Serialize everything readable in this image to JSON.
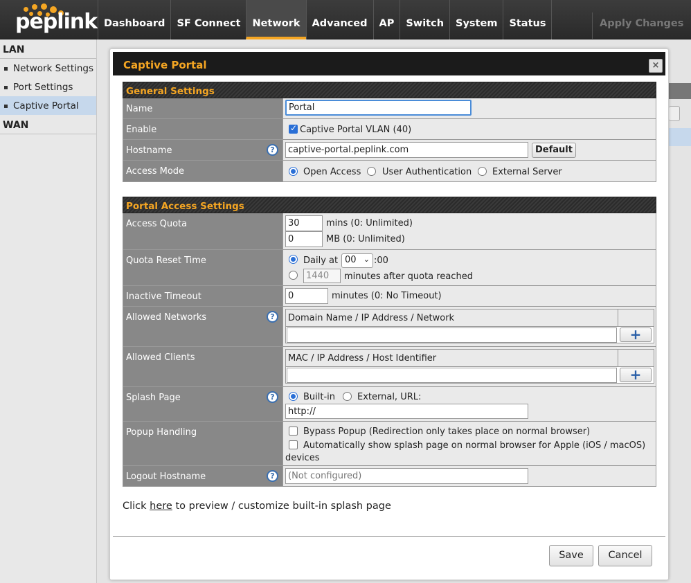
{
  "brand": {
    "logo_text": "peplink",
    "accent": "#f5a623"
  },
  "nav": {
    "items": [
      "Dashboard",
      "SF Connect",
      "Network",
      "Advanced",
      "AP",
      "Switch",
      "System",
      "Status"
    ],
    "active": "Network",
    "apply_label": "Apply Changes"
  },
  "sidebar": {
    "lan_header": "LAN",
    "items": [
      "Network Settings",
      "Port Settings",
      "Captive Portal"
    ],
    "active": "Captive Portal",
    "wan_header": "WAN"
  },
  "dialog": {
    "title": "Captive Portal",
    "close_icon": "×",
    "general": {
      "header": "General Settings",
      "name_label": "Name",
      "name_value": "Portal",
      "enable_label": "Enable",
      "enable_text": "Captive Portal VLAN (40)",
      "hostname_label": "Hostname",
      "hostname_value": "captive-portal.peplink.com",
      "default_button": "Default",
      "access_mode_label": "Access Mode",
      "access_modes": [
        "Open Access",
        "User Authentication",
        "External Server"
      ]
    },
    "portal": {
      "header": "Portal Access Settings",
      "quota_label": "Access Quota",
      "quota_mins_value": "30",
      "quota_mins_text": "mins (0: Unlimited)",
      "quota_mb_value": "0",
      "quota_mb_text": "MB (0: Unlimited)",
      "reset_label": "Quota Reset Time",
      "reset_daily_text": "Daily at",
      "reset_hour": "00",
      "reset_suffix": ":00",
      "reset_minutes_value": "1440",
      "reset_minutes_text": "minutes after quota reached",
      "inactive_label": "Inactive Timeout",
      "inactive_value": "0",
      "inactive_text": "minutes (0: No Timeout)",
      "allowed_networks_label": "Allowed Networks",
      "allowed_networks_header": "Domain Name / IP Address / Network",
      "allowed_clients_label": "Allowed Clients",
      "allowed_clients_header": "MAC / IP Address / Host Identifier",
      "plus_icon": "+",
      "splash_label": "Splash Page",
      "splash_builtin": "Built-in",
      "splash_external": "External, URL:",
      "splash_url_value": "http://",
      "popup_label": "Popup Handling",
      "popup_bypass": "Bypass Popup (Redirection only takes place on normal browser)",
      "popup_apple_line1": "Automatically show splash page on normal browser for Apple (iOS / macOS)",
      "popup_apple_line2": "devices",
      "logout_label": "Logout Hostname",
      "logout_placeholder": "(Not configured)",
      "help_icon": "?"
    },
    "preview": {
      "prefix": "Click",
      "link": "here",
      "suffix": "to preview / customize built-in splash page"
    },
    "save_button": "Save",
    "cancel_button": "Cancel"
  }
}
